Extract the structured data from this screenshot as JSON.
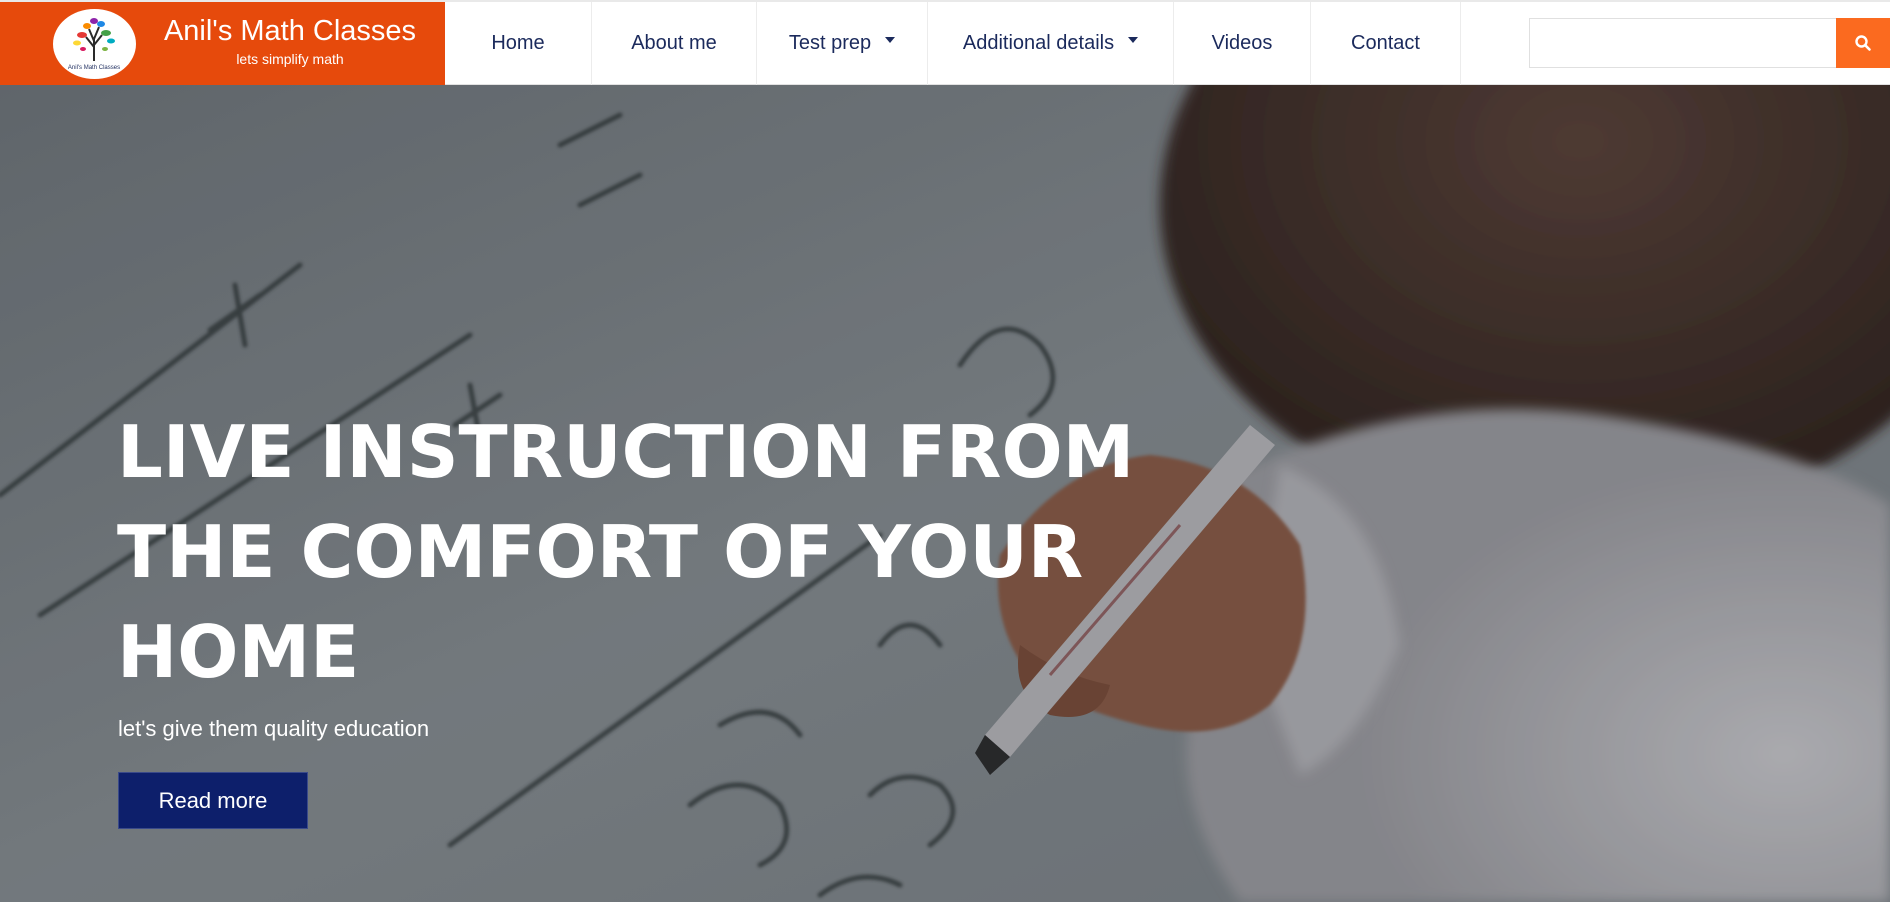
{
  "brand": {
    "title": "Anil's Math Classes",
    "subtitle": "lets simplify math",
    "logo_text": "Anil's Math Classes",
    "color": "#e64a0c"
  },
  "nav": {
    "items": [
      {
        "label": "Home",
        "has_dropdown": false
      },
      {
        "label": "About me",
        "has_dropdown": false
      },
      {
        "label": "Test prep",
        "has_dropdown": true
      },
      {
        "label": "Additional details",
        "has_dropdown": true
      },
      {
        "label": "Videos",
        "has_dropdown": false
      },
      {
        "label": "Contact",
        "has_dropdown": false
      }
    ],
    "text_color": "#1b2a5c"
  },
  "search": {
    "value": "",
    "icon": "search-icon",
    "button_color": "#fb6a1f"
  },
  "hero": {
    "title": "LIVE INSTRUCTION FROM THE COMFORT OF YOUR HOME",
    "subtitle": "let's give them quality education",
    "button_label": "Read more",
    "button_color": "#0d1f6b"
  }
}
